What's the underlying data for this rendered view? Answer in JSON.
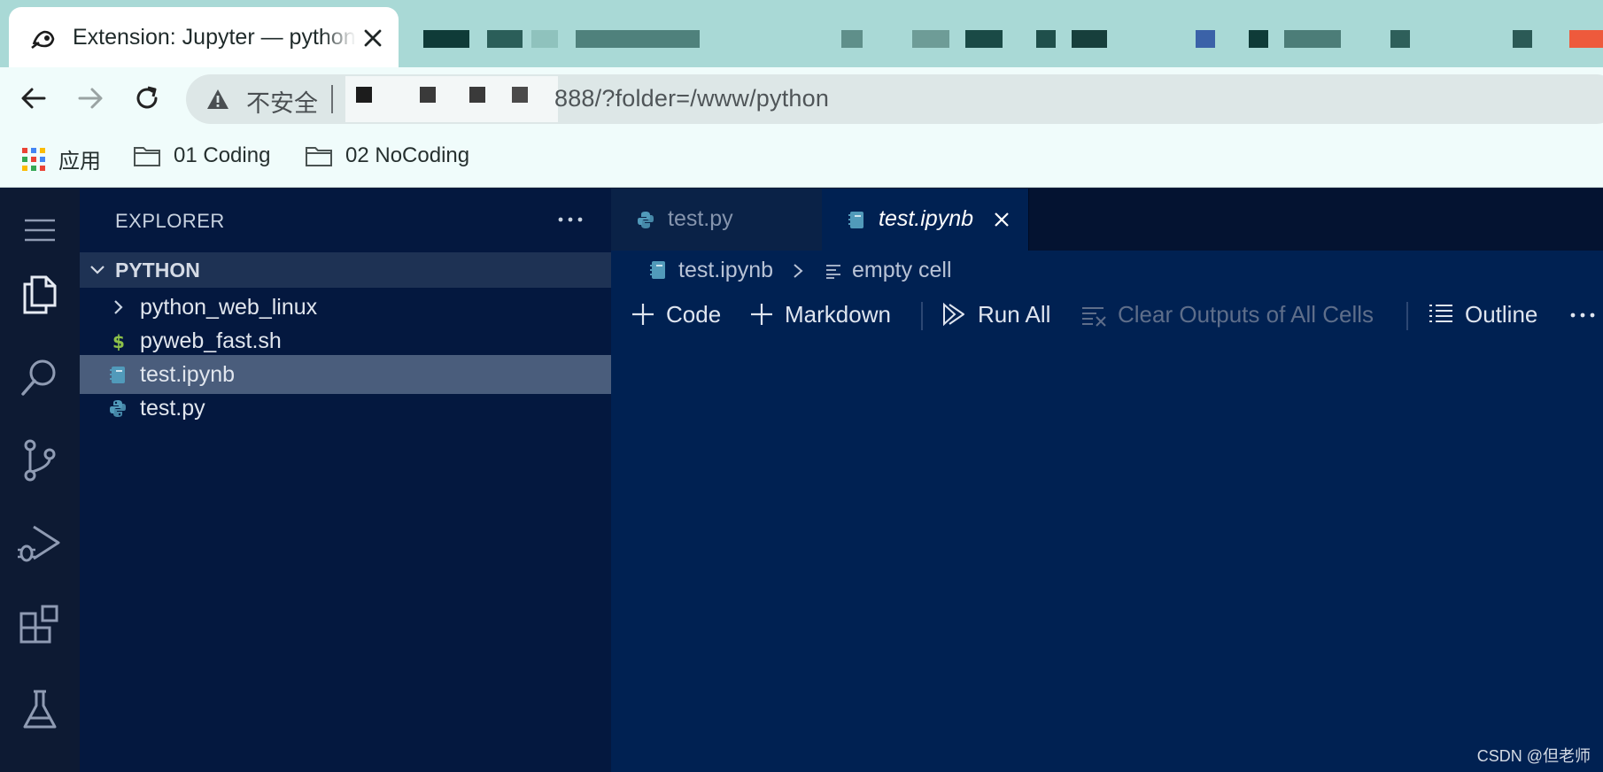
{
  "browser": {
    "tab_title": "Extension: Jupyter — python",
    "insecure_label": "不安全",
    "url": "888/?folder=/www/python",
    "bookmarks": [
      {
        "label": "应用"
      },
      {
        "label": "01 Coding"
      },
      {
        "label": "02 NoCoding"
      }
    ]
  },
  "explorer": {
    "title": "EXPLORER",
    "folder": "PYTHON",
    "items": [
      {
        "name": "python_web_linux",
        "type": "folder"
      },
      {
        "name": "pyweb_fast.sh",
        "type": "shell"
      },
      {
        "name": "test.ipynb",
        "type": "notebook",
        "selected": true
      },
      {
        "name": "test.py",
        "type": "python"
      }
    ]
  },
  "editor": {
    "tabs": [
      {
        "label": "test.py",
        "active": false
      },
      {
        "label": "test.ipynb",
        "active": true
      }
    ],
    "breadcrumb": {
      "file": "test.ipynb",
      "cell": "empty cell"
    },
    "toolbar": {
      "code": "Code",
      "markdown": "Markdown",
      "run_all": "Run All",
      "clear_outputs": "Clear Outputs of All Cells",
      "outline": "Outline"
    }
  },
  "watermark": "CSDN @但老师",
  "colors": {
    "tabstrip": "#a9d9d6",
    "activity_bar": "#0d1a33",
    "sidebar": "#04183f",
    "editor": "#002152",
    "selection": "#4a5d7c"
  }
}
